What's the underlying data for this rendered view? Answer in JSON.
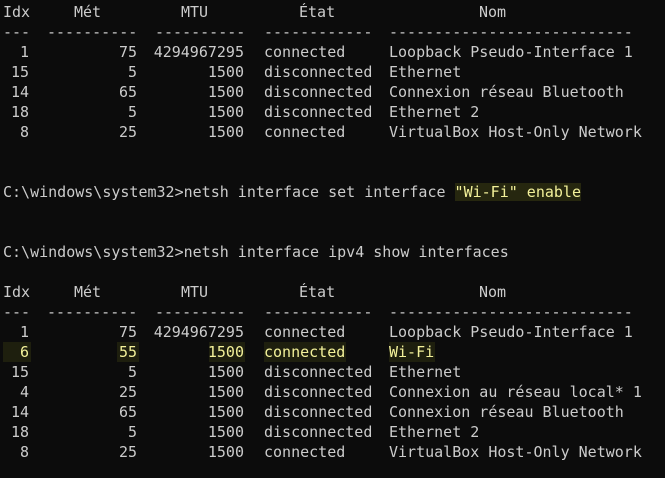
{
  "window": {
    "background": "#0c0c0c",
    "text_color": "#cccccc",
    "highlight_color": "#f3f19a"
  },
  "table1": {
    "headers": {
      "idx": "Idx",
      "met": "Mét",
      "mtu": "MTU",
      "etat": "État",
      "nom": "Nom"
    },
    "dashes": {
      "idx": "---",
      "met": "----------",
      "mtu": "----------",
      "etat": "------------",
      "nom": "---------------------------"
    },
    "rows": [
      {
        "idx": "1",
        "met": "75",
        "mtu": "4294967295",
        "etat": "connected",
        "nom": "Loopback Pseudo-Interface 1"
      },
      {
        "idx": "15",
        "met": "5",
        "mtu": "1500",
        "etat": "disconnected",
        "nom": "Ethernet"
      },
      {
        "idx": "14",
        "met": "65",
        "mtu": "1500",
        "etat": "disconnected",
        "nom": "Connexion réseau Bluetooth"
      },
      {
        "idx": "18",
        "met": "5",
        "mtu": "1500",
        "etat": "disconnected",
        "nom": "Ethernet 2"
      },
      {
        "idx": "8",
        "met": "25",
        "mtu": "1500",
        "etat": "connected",
        "nom": "VirtualBox Host-Only Network"
      }
    ]
  },
  "command1": {
    "prompt": "C:\\windows\\system32>netsh interface set interface ",
    "highlight": "\"Wi-Fi\" enable"
  },
  "command2": {
    "prompt": "C:\\windows\\system32>netsh interface ipv4 show interfaces"
  },
  "table2": {
    "headers": {
      "idx": "Idx",
      "met": "Mét",
      "mtu": "MTU",
      "etat": "État",
      "nom": "Nom"
    },
    "dashes": {
      "idx": "---",
      "met": "----------",
      "mtu": "----------",
      "etat": "------------",
      "nom": "---------------------------"
    },
    "rows": [
      {
        "idx": "1",
        "met": "75",
        "mtu": "4294967295",
        "etat": "connected",
        "nom": "Loopback Pseudo-Interface 1"
      },
      {
        "idx": "6",
        "met": "55",
        "mtu": "1500",
        "etat": "connected",
        "nom": "Wi-Fi"
      },
      {
        "idx": "15",
        "met": "5",
        "mtu": "1500",
        "etat": "disconnected",
        "nom": "Ethernet"
      },
      {
        "idx": "4",
        "met": "25",
        "mtu": "1500",
        "etat": "disconnected",
        "nom": "Connexion au réseau local* 1"
      },
      {
        "idx": "14",
        "met": "65",
        "mtu": "1500",
        "etat": "disconnected",
        "nom": "Connexion réseau Bluetooth"
      },
      {
        "idx": "18",
        "met": "5",
        "mtu": "1500",
        "etat": "disconnected",
        "nom": "Ethernet 2"
      },
      {
        "idx": "8",
        "met": "25",
        "mtu": "1500",
        "etat": "connected",
        "nom": "VirtualBox Host-Only Network"
      }
    ]
  }
}
